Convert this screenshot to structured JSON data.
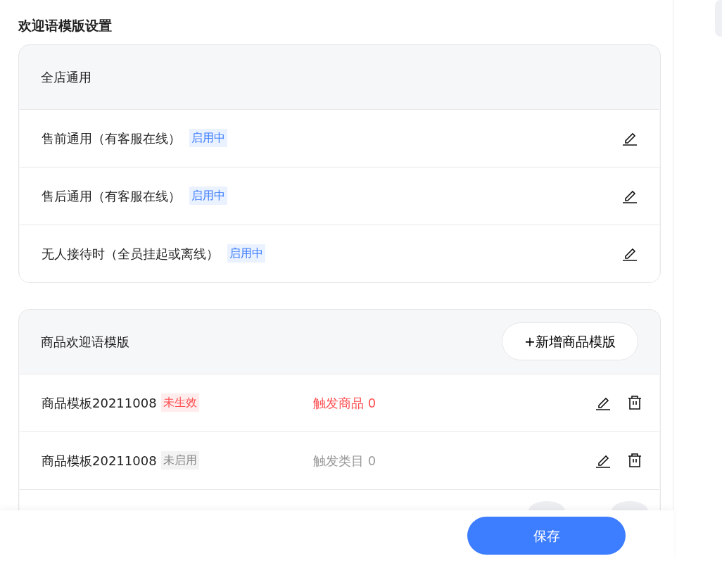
{
  "page_title": "欢迎语模版设置",
  "store_section": {
    "title": "全店通用",
    "items": [
      {
        "name": "售前通用（有客服在线）",
        "kind": "enabled",
        "status_label": "启用中"
      },
      {
        "name": "售后通用（有客服在线）",
        "kind": "enabled",
        "status_label": "启用中"
      },
      {
        "name": "无人接待时（全员挂起或离线）",
        "kind": "enabled",
        "status_label": "启用中"
      }
    ]
  },
  "product_section": {
    "title": "商品欢迎语模版",
    "add_button": "+新增商品模版",
    "items": [
      {
        "name": "商品模板20211008",
        "kind": "ineffective",
        "status_label": "未生效",
        "trigger": "触发商品 0"
      },
      {
        "name": "商品模板20211008",
        "kind": "disabled",
        "status_label": "未启用",
        "trigger": "触发类目 0"
      }
    ]
  },
  "save_button": "保存"
}
